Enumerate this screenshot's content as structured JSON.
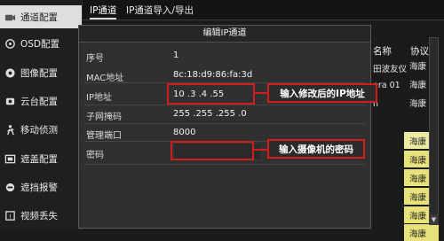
{
  "sidebar": {
    "items": [
      {
        "label": "通道配置",
        "icon": "camera-icon",
        "active": true
      },
      {
        "label": "OSD配置",
        "icon": "osd-icon"
      },
      {
        "label": "图像配置",
        "icon": "image-icon"
      },
      {
        "label": "云台配置",
        "icon": "ptz-icon"
      },
      {
        "label": "移动侦测",
        "icon": "motion-icon"
      },
      {
        "label": "遮盖配置",
        "icon": "mask-icon"
      },
      {
        "label": "遮挡报警",
        "icon": "tamper-icon"
      },
      {
        "label": "视频丢失",
        "icon": "video-loss-icon"
      }
    ]
  },
  "tabs": [
    "IP通道",
    "IP通道导入/导出"
  ],
  "background_list": {
    "headers": [
      "名称",
      "协议"
    ],
    "name_cells": [
      "田波友仪",
      "era 01",
      "n"
    ],
    "protocol_cells": [
      "海康",
      "海康",
      "海康",
      "海康",
      "海康",
      "海康",
      "海康",
      "海康",
      "海康"
    ]
  },
  "dialog": {
    "title": "编辑IP通道",
    "rows": [
      {
        "label": "序号",
        "value": "1"
      },
      {
        "label": "MAC地址",
        "value": "8c:18:d9:86:fa:3d"
      },
      {
        "label": "IP地址",
        "value": "10  .3    .4    .55"
      },
      {
        "label": "子网掩码",
        "value": "255 .255 .255 .0"
      },
      {
        "label": "管理端口",
        "value": "8000"
      },
      {
        "label": "密码",
        "value": ""
      }
    ]
  },
  "annotations": {
    "ip_note": "输入修改后的IP地址",
    "password_note": "输入摄像机的密码"
  },
  "colors": {
    "annotation_red": "#d21d1d",
    "protocol_highlight": "#e8e27a"
  }
}
